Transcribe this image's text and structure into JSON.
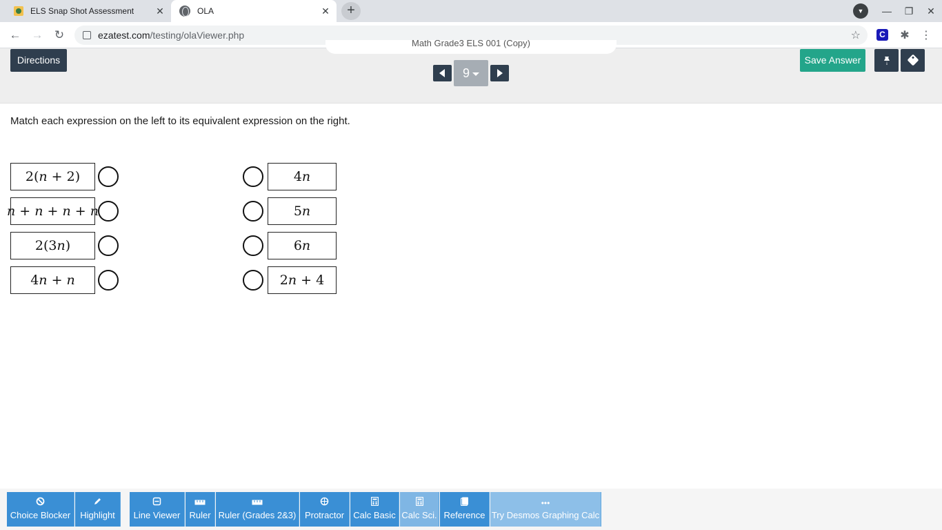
{
  "browser": {
    "tabs": [
      {
        "title": "ELS Snap Shot Assessment",
        "active": false
      },
      {
        "title": "OLA",
        "active": true
      }
    ],
    "url_domain": "ezatest.com",
    "url_path": "/testing/olaViewer.php"
  },
  "header": {
    "test_title": "Math Grade3 ELS 001 (Copy)",
    "directions_label": "Directions",
    "question_number": "9",
    "save_label": "Save Answer"
  },
  "question": {
    "prompt": "Match each expression on the left to its equivalent expression on the right.",
    "left_items": [
      "2(n + 2)",
      "n + n + n + n",
      "2(3n)",
      "4n + n"
    ],
    "right_items": [
      "4n",
      "5n",
      "6n",
      "2n + 4"
    ]
  },
  "tools": [
    {
      "label": "Choice Blocker",
      "icon": "block-icon"
    },
    {
      "label": "Highlight",
      "icon": "pencil-icon"
    },
    {
      "label": "Line Viewer",
      "icon": "line-viewer-icon"
    },
    {
      "label": "Ruler",
      "icon": "ruler-icon"
    },
    {
      "label": "Ruler (Grades 2&3)",
      "icon": "ruler-icon"
    },
    {
      "label": "Protractor",
      "icon": "protractor-icon"
    },
    {
      "label": "Calc Basic",
      "icon": "calculator-icon"
    },
    {
      "label": "Calc Sci.",
      "icon": "calculator-icon"
    },
    {
      "label": "Reference",
      "icon": "book-icon"
    },
    {
      "label": "Try Desmos Graphing Calc",
      "icon": "ellipsis-icon"
    }
  ],
  "colors": {
    "dark_button": "#2f3e4e",
    "save_button": "#23a58a",
    "tool_blue": "#3a8fd5"
  }
}
